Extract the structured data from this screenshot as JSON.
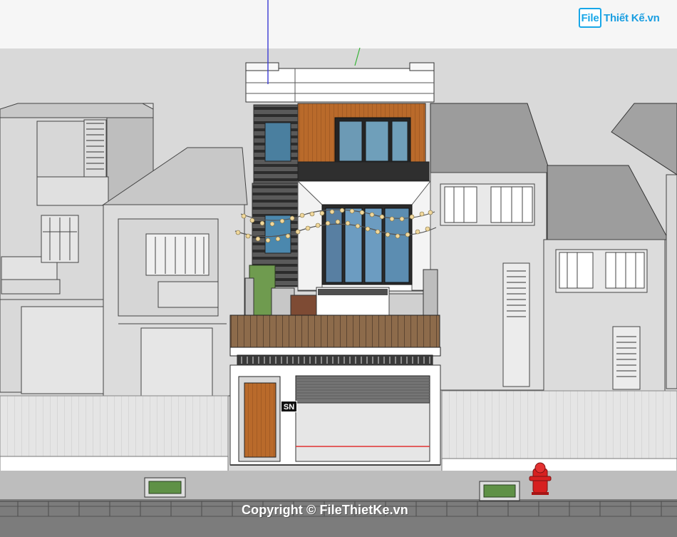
{
  "watermark": {
    "logo_file": "File",
    "logo_site": "Thiết Kế.vn",
    "copyright": "Copyright © FileThietKe.vn"
  },
  "house": {
    "signage": "SN"
  },
  "colors": {
    "sky": "#f6f6f6",
    "ground": "#d9d9d9",
    "accent": "#18a7e8",
    "hydrant": "#d72020",
    "wood": "#b96a2b"
  }
}
